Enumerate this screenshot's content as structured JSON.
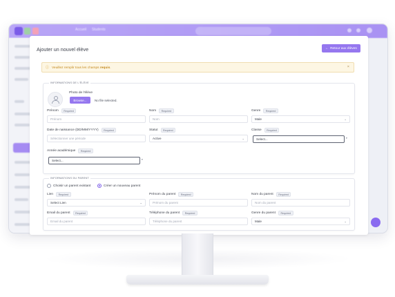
{
  "app": {
    "topbar_items": [
      "Accueil",
      "Students"
    ]
  },
  "page": {
    "title": "Ajouter un nouvel élève",
    "back_button": "Retour aux élèves"
  },
  "alert": {
    "text": "Veuillez remplir tous les champs ",
    "strong": "requis",
    "suffix": ".",
    "close": "×"
  },
  "required_badge": "Required",
  "student_section": {
    "title": "INFORMATIONS DE L'ÉLÈVE",
    "photo_label": "Photo de l'élève",
    "browse_button": "Browse...",
    "no_file": "No file selected.",
    "fields": {
      "prenom": {
        "label": "Prénom",
        "placeholder": "Prénom"
      },
      "nom": {
        "label": "Nom",
        "placeholder": "Nom"
      },
      "genre": {
        "label": "Genre",
        "value": "Male"
      },
      "date_naissance": {
        "label": "Date de naissance (DD/MM/YYYY)",
        "placeholder": "Sélectionner une période"
      },
      "statut": {
        "label": "Statut",
        "value": "Active"
      },
      "classe": {
        "label": "Classe",
        "value": "Select..."
      },
      "annee": {
        "label": "Année académique",
        "value": "Select..."
      }
    }
  },
  "parent_section": {
    "title": "INFORMATIONS DU PARENT",
    "radio_existing": "Choisir un parent existant",
    "radio_new": "Créer un nouveau parent",
    "selected": "new",
    "fields": {
      "lien": {
        "label": "Lien",
        "value": "Select Lien"
      },
      "prenom_parent": {
        "label": "Prénom du parent",
        "placeholder": "Prénom du parent"
      },
      "nom_parent": {
        "label": "Nom du parent",
        "placeholder": "Nom du parent"
      },
      "email_parent": {
        "label": "Email du parent",
        "placeholder": "Email du parent"
      },
      "tel_parent": {
        "label": "Téléphone du parent",
        "placeholder": "Téléphone du parent"
      },
      "genre_parent": {
        "label": "Genre du parent",
        "value": "Male"
      }
    }
  },
  "colors": {
    "accent": "#9577ef",
    "topbar": "#b39ff6",
    "alert_bg": "#fdf6e3",
    "alert_text": "#c4891e"
  },
  "icons": [
    "user-avatar-icon",
    "arrow-left-icon",
    "warning-icon",
    "close-icon",
    "chevron-down-icon",
    "radio-icon"
  ]
}
